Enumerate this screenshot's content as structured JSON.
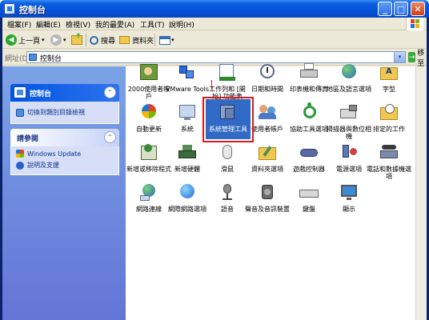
{
  "window": {
    "title": "控制台",
    "min_label": "_",
    "max_label": "□",
    "close_label": "✕"
  },
  "menu": {
    "items": [
      "檔案(F)",
      "編輯(E)",
      "檢視(V)",
      "我的最愛(A)",
      "工具(T)",
      "說明(H)"
    ]
  },
  "toolbar": {
    "back_label": "上一頁",
    "back_glyph": "◀",
    "forward_glyph": "▶",
    "dropdown_glyph": "▾",
    "search_label": "搜尋",
    "folders_label": "資料夾"
  },
  "address": {
    "label": "網址(D)",
    "value": "控制台",
    "go_label": "移至",
    "dropdown_glyph": "▾",
    "go_glyph": "→"
  },
  "sidepanel": {
    "control_panel": {
      "title": "控制台",
      "collapse_glyph": "⌃",
      "links": [
        "切換到類別目錄檢視"
      ]
    },
    "see_also": {
      "title": "請參閱",
      "collapse_glyph": "⌃",
      "links": [
        "Windows Update",
        "說明及支援"
      ]
    }
  },
  "icons": [
    {
      "label": "2000使用者帳戶"
    },
    {
      "label": "VMware Tools"
    },
    {
      "label": "工作列和 [開始] 功能表"
    },
    {
      "label": "日期和時間"
    },
    {
      "label": "印表機和傳真"
    },
    {
      "label": "地區及語言選項"
    },
    {
      "label": "字型"
    },
    {
      "label": "自動更新"
    },
    {
      "label": "系統"
    },
    {
      "label": "系統管理工具"
    },
    {
      "label": "使用者帳戶"
    },
    {
      "label": "協助工具選項"
    },
    {
      "label": "掃描器與數位相機"
    },
    {
      "label": "排定的工作"
    },
    {
      "label": "新增或移除程式"
    },
    {
      "label": "新增硬體"
    },
    {
      "label": "滑鼠"
    },
    {
      "label": "資料夾選項"
    },
    {
      "label": "遊戲控制器"
    },
    {
      "label": "電源選項"
    },
    {
      "label": "電話和數據機選項"
    },
    {
      "label": "網路連線"
    },
    {
      "label": "網際網路選項"
    },
    {
      "label": "語音"
    },
    {
      "label": "聲音及音訊裝置"
    },
    {
      "label": "鍵盤"
    },
    {
      "label": "顯示"
    }
  ],
  "selected_icon": "系統管理工具",
  "colors": {
    "titlebar": "#0452d6",
    "selection": "#316ac5",
    "annotation_box": "#e01818",
    "sidepanel_bg": "#6375d6"
  }
}
